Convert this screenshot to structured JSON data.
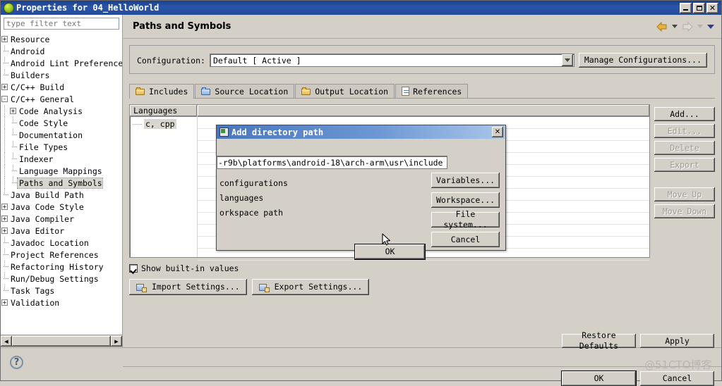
{
  "window": {
    "title": "Properties for 04_HelloWorld",
    "icon": "eclipse-circle-icon",
    "minimize_label": "_",
    "maximize_label": "□",
    "close_label": "✕"
  },
  "sidebar": {
    "filter_placeholder": "type filter text",
    "filter_value": "",
    "items": [
      {
        "label": "Resource",
        "indent": 0,
        "expander": "+"
      },
      {
        "label": "Android",
        "indent": 0,
        "expander": "leaf"
      },
      {
        "label": "Android Lint Preferences",
        "indent": 0,
        "expander": "leaf"
      },
      {
        "label": "Builders",
        "indent": 0,
        "expander": "leaf"
      },
      {
        "label": "C/C++ Build",
        "indent": 0,
        "expander": "+"
      },
      {
        "label": "C/C++ General",
        "indent": 0,
        "expander": "-"
      },
      {
        "label": "Code Analysis",
        "indent": 1,
        "expander": "+"
      },
      {
        "label": "Code Style",
        "indent": 1,
        "expander": "leaf"
      },
      {
        "label": "Documentation",
        "indent": 1,
        "expander": "leaf"
      },
      {
        "label": "File Types",
        "indent": 1,
        "expander": "leaf"
      },
      {
        "label": "Indexer",
        "indent": 1,
        "expander": "leaf"
      },
      {
        "label": "Language Mappings",
        "indent": 1,
        "expander": "leaf"
      },
      {
        "label": "Paths and Symbols",
        "indent": 1,
        "expander": "leaf",
        "selected": true
      },
      {
        "label": "Java Build Path",
        "indent": 0,
        "expander": "leaf"
      },
      {
        "label": "Java Code Style",
        "indent": 0,
        "expander": "+"
      },
      {
        "label": "Java Compiler",
        "indent": 0,
        "expander": "+"
      },
      {
        "label": "Java Editor",
        "indent": 0,
        "expander": "+"
      },
      {
        "label": "Javadoc Location",
        "indent": 0,
        "expander": "leaf"
      },
      {
        "label": "Project References",
        "indent": 0,
        "expander": "leaf"
      },
      {
        "label": "Refactoring History",
        "indent": 0,
        "expander": "leaf"
      },
      {
        "label": "Run/Debug Settings",
        "indent": 0,
        "expander": "leaf"
      },
      {
        "label": "Task Tags",
        "indent": 0,
        "expander": "leaf"
      },
      {
        "label": "Validation",
        "indent": 0,
        "expander": "+"
      }
    ]
  },
  "page": {
    "title": "Paths and Symbols",
    "nav": {
      "back_icon": "back-arrow-icon",
      "forward_icon": "forward-arrow-icon",
      "menu_icon": "view-menu-icon"
    },
    "configuration": {
      "label": "Configuration:",
      "value": "Default  [ Active ]",
      "manage_button": "Manage Configurations..."
    },
    "tabs": [
      {
        "label": "Includes",
        "icon": "includes-folder-icon",
        "active": true
      },
      {
        "label": "Source Location",
        "icon": "source-folder-icon",
        "active": false
      },
      {
        "label": "Output Location",
        "icon": "output-folder-icon",
        "active": false
      },
      {
        "label": "References",
        "icon": "references-page-icon",
        "active": false
      }
    ],
    "table": {
      "languages_header": "Languages",
      "languages_items": [
        "c, cpp"
      ],
      "paths_header": "",
      "rows": []
    },
    "side_buttons": [
      {
        "label": "Add...",
        "enabled": true
      },
      {
        "label": "Edit...",
        "enabled": false
      },
      {
        "label": "Delete",
        "enabled": false
      },
      {
        "label": "Export",
        "enabled": false
      },
      {
        "label": "Move Up",
        "enabled": false
      },
      {
        "label": "Move Down",
        "enabled": false
      }
    ],
    "show_builtin": {
      "label": "Show built-in values",
      "checked": true
    },
    "import_button": "Import Settings...",
    "export_button": "Export Settings..."
  },
  "footer": {
    "help_icon": "help-question-icon",
    "restore_defaults": "Restore Defaults",
    "apply": "Apply",
    "ok": "OK",
    "cancel": "Cancel"
  },
  "dialog": {
    "title": "Add directory path",
    "icon": "directory-dialog-icon",
    "close_label": "✕",
    "path_value": "-r9b\\platforms\\android-18\\arch-arm\\usr\\include",
    "lines": [
      "configurations",
      "languages",
      "orkspace path"
    ],
    "buttons": {
      "variables": "Variables...",
      "workspace": "Workspace...",
      "file_system": "File system...",
      "ok": "OK",
      "cancel": "Cancel"
    }
  },
  "watermark": "@51CTO博客"
}
